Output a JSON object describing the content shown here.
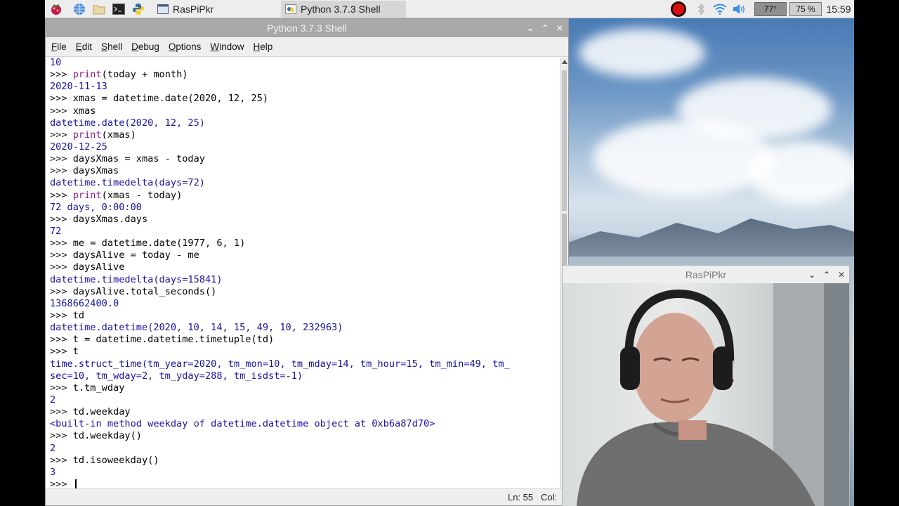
{
  "taskbar": {
    "launchers": [
      "raspberry-icon",
      "globe-icon",
      "folder-icon",
      "terminal-icon",
      "python-icon"
    ],
    "tasks": [
      {
        "label": "RasPiPkr",
        "icon": "window-icon"
      },
      {
        "label": "Python 3.7.3 Shell",
        "icon": "python-icon"
      }
    ],
    "cpu_temp": "77°",
    "cpu_usage": "75 %",
    "clock": "15:59",
    "status_icons": [
      "record-icon",
      "bluetooth-icon",
      "wifi-icon",
      "volume-icon"
    ]
  },
  "shell": {
    "title": "Python 3.7.3 Shell",
    "menu": [
      {
        "label": "File",
        "u": "F",
        "rest": "ile"
      },
      {
        "label": "Edit",
        "u": "E",
        "rest": "dit"
      },
      {
        "label": "Shell",
        "u": "S",
        "rest": "hell"
      },
      {
        "label": "Debug",
        "u": "D",
        "rest": "ebug"
      },
      {
        "label": "Options",
        "u": "O",
        "rest": "ptions"
      },
      {
        "label": "Window",
        "u": "W",
        "rest": "indow"
      },
      {
        "label": "Help",
        "u": "H",
        "rest": "elp"
      }
    ],
    "lines": [
      {
        "t": "out",
        "text": "10"
      },
      {
        "t": "in",
        "kw": "print",
        "text": "(today + month)"
      },
      {
        "t": "out",
        "text": "2020-11-13"
      },
      {
        "t": "in",
        "text": "xmas = datetime.date(2020, 12, 25)"
      },
      {
        "t": "in",
        "text": "xmas"
      },
      {
        "t": "out",
        "text": "datetime.date(2020, 12, 25)"
      },
      {
        "t": "in",
        "kw": "print",
        "text": "(xmas)"
      },
      {
        "t": "out",
        "text": "2020-12-25"
      },
      {
        "t": "in",
        "text": "daysXmas = xmas - today"
      },
      {
        "t": "in",
        "text": "daysXmas"
      },
      {
        "t": "out",
        "text": "datetime.timedelta(days=72)"
      },
      {
        "t": "in",
        "kw": "print",
        "text": "(xmas - today)"
      },
      {
        "t": "out",
        "text": "72 days, 0:00:00"
      },
      {
        "t": "in",
        "text": "daysXmas.days"
      },
      {
        "t": "out",
        "text": "72"
      },
      {
        "t": "in",
        "text": "me = datetime.date(1977, 6, 1)"
      },
      {
        "t": "in",
        "text": "daysAlive = today - me"
      },
      {
        "t": "in",
        "text": "daysAlive"
      },
      {
        "t": "out",
        "text": "datetime.timedelta(days=15841)"
      },
      {
        "t": "in",
        "text": "daysAlive.total_seconds()"
      },
      {
        "t": "out",
        "text": "1368662400.0"
      },
      {
        "t": "in",
        "text": "td"
      },
      {
        "t": "out",
        "text": "datetime.datetime(2020, 10, 14, 15, 49, 10, 232963)"
      },
      {
        "t": "in",
        "text": "t = datetime.datetime.timetuple(td)"
      },
      {
        "t": "in",
        "text": "t"
      },
      {
        "t": "out",
        "text": "time.struct_time(tm_year=2020, tm_mon=10, tm_mday=14, tm_hour=15, tm_min=49, tm_"
      },
      {
        "t": "out",
        "text": "sec=10, tm_wday=2, tm_yday=288, tm_isdst=-1)"
      },
      {
        "t": "in",
        "text": "t.tm_wday"
      },
      {
        "t": "out",
        "text": "2"
      },
      {
        "t": "in",
        "text": "td.weekday"
      },
      {
        "t": "out",
        "text": "<built-in method weekday of datetime.datetime object at 0xb6a87d70>"
      },
      {
        "t": "in",
        "text": "td.weekday()"
      },
      {
        "t": "out",
        "text": "2"
      },
      {
        "t": "in",
        "text": "td.isoweekday()"
      },
      {
        "t": "out",
        "text": "3"
      },
      {
        "t": "in",
        "text": ""
      }
    ],
    "prompt": ">>> ",
    "status_ln": "Ln: 55",
    "status_col": "Col:"
  },
  "camera": {
    "title": "RasPiPkr"
  }
}
